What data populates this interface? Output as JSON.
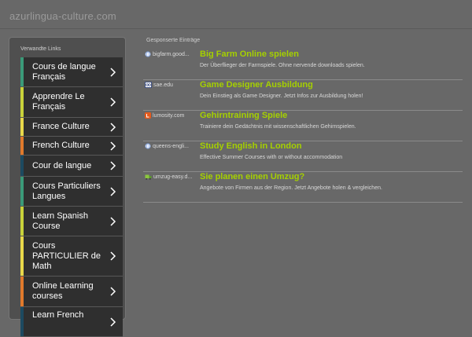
{
  "header": {
    "site_title": "azurlingua-culture.com"
  },
  "sidebar": {
    "heading": "Verwandte Links",
    "items": [
      {
        "label": "Cours de langue Français",
        "color": "#3a9a78"
      },
      {
        "label": "Apprendre Le Français",
        "color": "#c8d23a"
      },
      {
        "label": "France Culture",
        "color": "#e8d84a"
      },
      {
        "label": "French Culture",
        "color": "#e07a2c"
      },
      {
        "label": "Cour de langue",
        "color": "#1d4a60"
      },
      {
        "label": "Cours Particuliers Langues",
        "color": "#3a9a78"
      },
      {
        "label": "Learn Spanish Course",
        "color": "#c8d23a"
      },
      {
        "label": "Cours PARTICULIER de Math",
        "color": "#e8d84a"
      },
      {
        "label": "Online Learning courses",
        "color": "#e07a2c"
      },
      {
        "label": "Learn French",
        "color": "#1d4a60"
      }
    ]
  },
  "sponsored": {
    "heading": "Gesponserte Einträge",
    "ads": [
      {
        "domain": "bigfarm.good...",
        "title": "Big Farm Online spielen",
        "description": "Der Überflieger der Farmspiele. Ohne nervende downloads spielen.",
        "favicon": "globe-icon"
      },
      {
        "domain": "sae.edu",
        "title": "Game Designer Ausbildung",
        "description": "Dein Einstieg als Game Designer. Jetzt Infos zur Ausbildung holen!",
        "favicon": "sae-icon"
      },
      {
        "domain": "lumosity.com",
        "title": "Gehirntraining Spiele",
        "description": "Trainiere dein Gedächtnis mit wissenschaftlichen Gehirnspielen.",
        "favicon": "lumosity-icon"
      },
      {
        "domain": "queens-engli...",
        "title": "Study English in London",
        "description": "Effective Summer Courses with or without accommodation",
        "favicon": "globe-icon"
      },
      {
        "domain": "umzug-easy.d...",
        "title": "Sie planen einen Umzug?",
        "description": "Angebote von Firmen aus der Region. Jetzt Angebote holen & vergleichen.",
        "favicon": "truck-icon"
      }
    ]
  }
}
